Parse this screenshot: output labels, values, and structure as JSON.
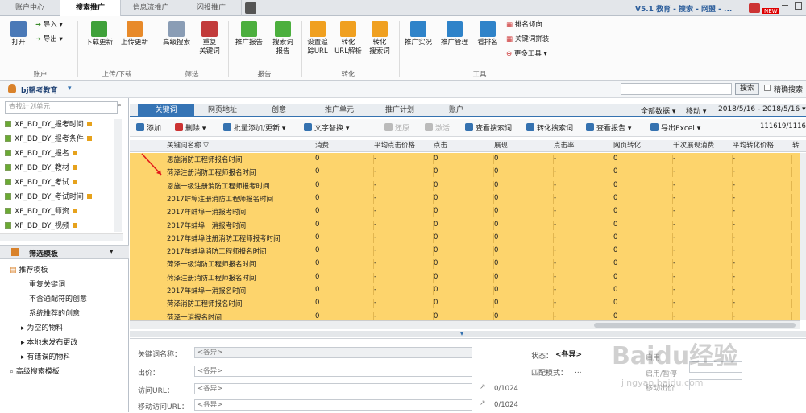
{
  "top_tabs": [
    "账户中心",
    "搜索推广",
    "信息流推广",
    "闪投推广"
  ],
  "top_right": {
    "version": "V5.1 教育 - 搜索 - 网盟 - ...",
    "badge": "NEW"
  },
  "ribbon": {
    "account": {
      "open": "打开",
      "import": "导入",
      "export": "导出",
      "group": "账户"
    },
    "updown": {
      "download": "下载更新",
      "upload": "上传更新",
      "group": "上传/下载"
    },
    "filter": {
      "advsearch": "高级搜索",
      "dup": "重复\n关键词",
      "group": "筛选"
    },
    "report": {
      "promo": "推广报告",
      "kwreport": "搜索词\n报告",
      "group": "报告"
    },
    "convert": {
      "track": "设置追\n踪URL",
      "parse": "转化\nURL解析",
      "kwconv": "转化\n搜索词",
      "group": "转化"
    },
    "tools": {
      "live": "推广实况",
      "mgr": "推广管理",
      "rank": "看排名",
      "rankdir": "排名倾向",
      "kwbox": "关键词拼装",
      "more": "更多工具",
      "group": "工具"
    }
  },
  "user": {
    "name": "bj帮考教育",
    "search_btn": "搜索",
    "exact": "精确搜索"
  },
  "left": {
    "search_placeholder": "查找计划单元",
    "plans": [
      "XF_BD_DY_报考时间",
      "XF_BD_DY_报考条件",
      "XF_BD_DY_报名",
      "XF_BD_DY_教材",
      "XF_BD_DY_考试",
      "XF_BD_DY_考试时间",
      "XF_BD_DY_师资",
      "XF_BD_DY_视频"
    ],
    "filter_title": "筛选模板",
    "tree_root": "推荐模板",
    "tree": [
      "重复关键词",
      "不含通配符的创意",
      "系统推荐的创意"
    ],
    "tree2": [
      "为空的物料",
      "本地未发布更改",
      "有错误的物料"
    ],
    "adv": "高级搜索模板"
  },
  "main_tabs": [
    "关键词",
    "网页地址",
    "创意",
    "推广单元",
    "推广计划",
    "账户"
  ],
  "range": {
    "data": "全部数据",
    "move": "移动",
    "dates": "2018/5/16 - 2018/5/16"
  },
  "toolbar": [
    "添加",
    "删除",
    "批量添加/更新",
    "文字替换",
    "还原",
    "激活",
    "查看搜索词",
    "转化搜索词",
    "查看报告",
    "导出Excel"
  ],
  "count": "111619/111619",
  "columns": [
    "关键词名称",
    "消费",
    "平均点击价格",
    "点击",
    "展现",
    "点击率",
    "网页转化",
    "千次展现消费",
    "平均转化价格",
    "转"
  ],
  "rows": [
    "恩施消防工程师报名时间",
    "菏泽注册消防工程师报名时间",
    "恩施一级注册消防工程师报考时间",
    "2017蚌埠注册消防工程师报名时间",
    "2017年蚌埠一消报考时间",
    "2017年蚌埠一消报考时间",
    "2017年蚌埠注册消防工程师报考时间",
    "2017年蚌埠消防工程师报名时间",
    "菏泽一级消防工程师报名时间",
    "菏泽注册消防工程师报名时间",
    "2017年蚌埠一消报名时间",
    "菏泽消防工程师报名时间",
    "菏泽一消报名时间"
  ],
  "cell_values": {
    "spend": "0",
    "avg": "-",
    "clicks": "0",
    "shows": "0",
    "ctr": "-",
    "conv": "0",
    "cpm": "-",
    "avgconv": "-"
  },
  "detail": {
    "kw_label": "关键词名称：",
    "price": "出价：",
    "url": "访问URL：",
    "murl": "移动访问URL：",
    "value": "<各异>",
    "status_label": "状态：",
    "status": "<各异>",
    "match": "匹配模式：",
    "match_val": "...",
    "counter": "0/1024",
    "right1": "启用",
    "right2": "启用/暂停",
    "right3": "移动出价"
  },
  "watermark": "Baidu经验",
  "watermark2": "jingyan.baidu.com",
  "colors": {
    "row_bg": "#fdd46c",
    "tab_active": "#3574b5"
  }
}
